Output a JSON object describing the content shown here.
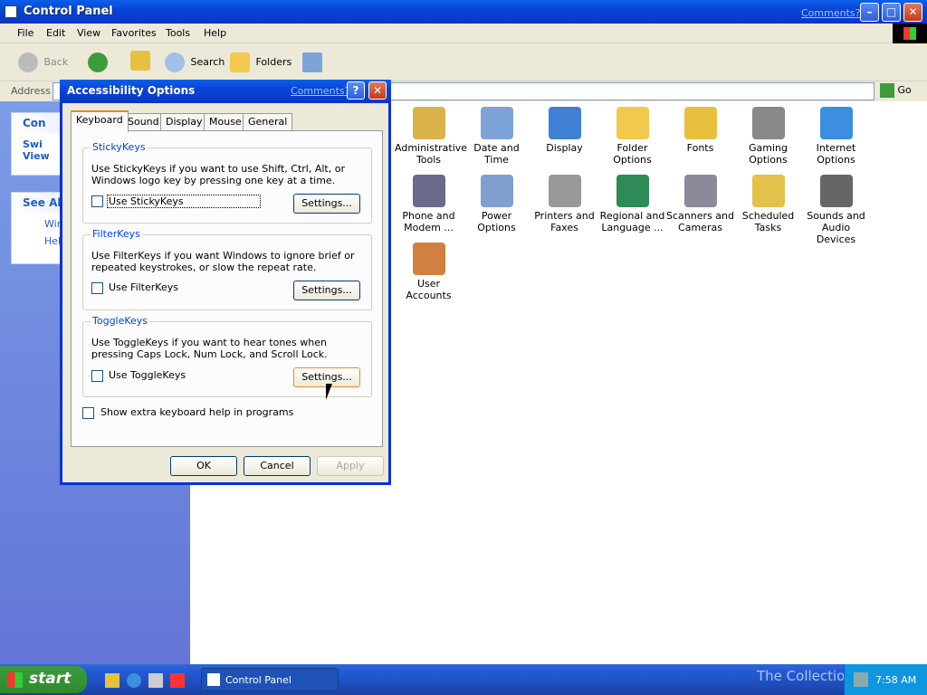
{
  "window": {
    "title": "Control Panel",
    "comments": "Comments?",
    "minimize": "–",
    "maximize": "□",
    "close": "✕"
  },
  "menu": [
    "File",
    "Edit",
    "View",
    "Favorites",
    "Tools",
    "Help"
  ],
  "toolbar": {
    "back": "Back",
    "search": "Search",
    "folders": "Folders"
  },
  "address": {
    "label": "Address",
    "go": "Go",
    "value": ""
  },
  "left_panel": {
    "box1_title": "Con",
    "box1_item": "Swi\nView",
    "box2_title": "See Als",
    "box2_items": [
      "Wind",
      "Help"
    ]
  },
  "icons": [
    {
      "label": "Administrative Tools",
      "icon": "admin-tools-icon",
      "color": "#d9b24a"
    },
    {
      "label": "Date and Time",
      "icon": "clock-icon",
      "color": "#7da3d9"
    },
    {
      "label": "Display",
      "icon": "monitor-icon",
      "color": "#3f7fd4"
    },
    {
      "label": "Folder Options",
      "icon": "folder-icon",
      "color": "#f2c94c"
    },
    {
      "label": "Fonts",
      "icon": "fonts-folder-icon",
      "color": "#e8c040"
    },
    {
      "label": "Gaming Options",
      "icon": "joystick-icon",
      "color": "#888888"
    },
    {
      "label": "Internet Options",
      "icon": "globe-icon",
      "color": "#3b8ee0"
    },
    {
      "label": "Phone and Modem ...",
      "icon": "phone-icon",
      "color": "#6a6a8a"
    },
    {
      "label": "Power Options",
      "icon": "power-icon",
      "color": "#7f9fcf"
    },
    {
      "label": "Printers and Faxes",
      "icon": "printer-icon",
      "color": "#999999"
    },
    {
      "label": "Regional and Language ...",
      "icon": "globe-icon",
      "color": "#2e8b57"
    },
    {
      "label": "Scanners and Cameras",
      "icon": "scanner-icon",
      "color": "#8a8a9a"
    },
    {
      "label": "Scheduled Tasks",
      "icon": "tasks-folder-icon",
      "color": "#e3c14a"
    },
    {
      "label": "Sounds and Audio Devices",
      "icon": "speaker-icon",
      "color": "#666666"
    },
    {
      "label": "User Accounts",
      "icon": "users-icon",
      "color": "#d08040"
    }
  ],
  "dialog": {
    "title": "Accessibility Options",
    "comments": "Comments?",
    "tabs": [
      "Keyboard",
      "Sound",
      "Display",
      "Mouse",
      "General"
    ],
    "selected_tab": "Keyboard",
    "sticky": {
      "title": "StickyKeys",
      "desc": "Use StickyKeys if you want to use Shift, Ctrl, Alt, or Windows logo key by pressing one key at a time.",
      "check": "Use StickyKeys",
      "checked": false,
      "settings": "Settings..."
    },
    "filter": {
      "title": "FilterKeys",
      "desc": "Use FilterKeys if you want Windows to ignore brief or repeated keystrokes, or slow the repeat rate.",
      "check": "Use FilterKeys",
      "checked": false,
      "settings": "Settings..."
    },
    "toggle": {
      "title": "ToggleKeys",
      "desc": "Use ToggleKeys if you want to hear tones when pressing Caps Lock, Num Lock, and Scroll Lock.",
      "check": "Use ToggleKeys",
      "checked": false,
      "settings": "Settings..."
    },
    "extra": {
      "check": "Show extra keyboard help in programs",
      "checked": false
    },
    "ok": "OK",
    "cancel": "Cancel",
    "apply": "Apply"
  },
  "taskbar": {
    "start": "start",
    "task": "Control Panel",
    "clock": "7:58 AM",
    "watermark": "The Collection Book"
  }
}
